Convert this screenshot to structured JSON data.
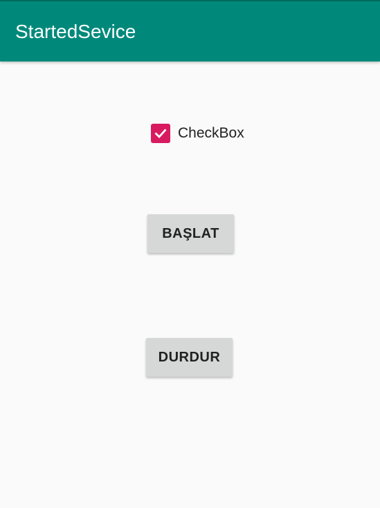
{
  "app_bar": {
    "title": "StartedSevice",
    "color": "#00897B"
  },
  "checkbox": {
    "label": "CheckBox",
    "checked": true,
    "icon": "check-icon",
    "color": "#D81B60"
  },
  "buttons": {
    "start_label": "BAŞLAT",
    "stop_label": "DURDUR"
  }
}
